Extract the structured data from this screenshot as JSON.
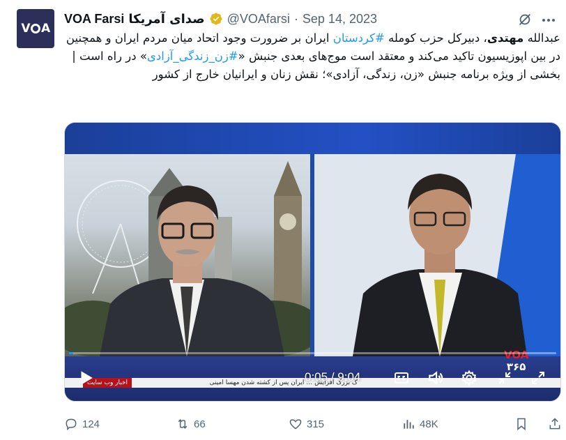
{
  "tweet": {
    "author_name": "VOA Farsi",
    "author_name_fa": "صدای آمریکا",
    "handle": "@VOAfarsi",
    "separator": "·",
    "date": "Sep 14, 2023",
    "avatar_text_v": "V",
    "avatar_text_a": "A",
    "text": {
      "p1": "عبدالله ",
      "p2": "مهتدی",
      "p3": "، دبیرکل حزب کومله ",
      "p4": "#کردستان",
      "p5": " ایران بر ضرورت وجود اتحاد میان مردم ایران و همچنین در بین اپوزیسیون تاکید می‌کند و معتقد است موج‌های بعدی جنبش «",
      "p6": "#زن_زندگی_آزادی",
      "p7": "» در راه است | بخشی از ویژه برنامه جنبش «زن، زندگی، آزادی»؛ نقش زنان و ایرانیان خارج از کشور"
    }
  },
  "video": {
    "current_time": "0:05",
    "time_sep": " / ",
    "duration": "9:04",
    "progress": 0.009,
    "ticker_label": "اخبار وب سایت",
    "ticker_text": "ک بزرگ افزایش … ایران پس از کشته شدن مهسا امینی",
    "channel_logo_top": "VOA",
    "channel_logo_bottom": "۳۶۵",
    "icons": [
      "play-icon",
      "captions-icon",
      "volume-icon",
      "settings-icon",
      "minimize-icon",
      "fullscreen-icon"
    ]
  },
  "actions": {
    "replies": "124",
    "reposts": "66",
    "likes": "315",
    "views": "48K"
  },
  "colors": {
    "accent": "#1d9bf0",
    "muted": "#536471",
    "verified_gold": "#e2b719",
    "avatar_bg": "#2c2f5a"
  }
}
